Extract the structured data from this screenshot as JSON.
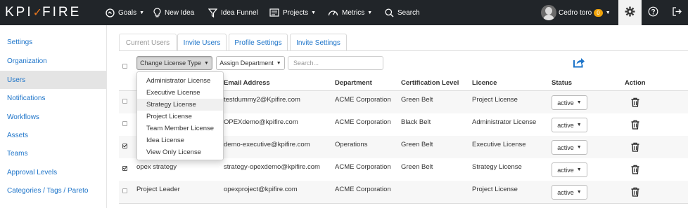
{
  "nav": {
    "logo_left": "KPI",
    "logo_right": "FIRE",
    "goals": "Goals",
    "new_idea": "New Idea",
    "idea_funnel": "Idea Funnel",
    "projects": "Projects",
    "metrics": "Metrics",
    "search": "Search",
    "user_name": "Cedro toro",
    "notification_count": "0"
  },
  "sidebar": {
    "items": [
      {
        "label": "Settings"
      },
      {
        "label": "Organization"
      },
      {
        "label": "Users"
      },
      {
        "label": "Notifications"
      },
      {
        "label": "Workflows"
      },
      {
        "label": "Assets"
      },
      {
        "label": "Teams"
      },
      {
        "label": "Approval Levels"
      },
      {
        "label": "Categories / Tags / Pareto"
      }
    ],
    "active_item": "Users"
  },
  "tabs": [
    {
      "label": "Current Users"
    },
    {
      "label": "Invite Users"
    },
    {
      "label": "Profile Settings"
    },
    {
      "label": "Invite Settings"
    }
  ],
  "toolbar": {
    "change_license_label": "Change License Type",
    "assign_department_label": "Assign Department",
    "search_placeholder": "Search..."
  },
  "license_menu": {
    "items": [
      {
        "label": "Administrator License"
      },
      {
        "label": "Executive License"
      },
      {
        "label": "Strategy License"
      },
      {
        "label": "Project License"
      },
      {
        "label": "Team Member License"
      },
      {
        "label": "Idea License"
      },
      {
        "label": "View Only License"
      }
    ],
    "highlighted": "Strategy License"
  },
  "table": {
    "columns": [
      "Email Address",
      "Department",
      "Certification Level",
      "Licence",
      "Status",
      "Action"
    ],
    "rows": [
      {
        "name": "",
        "email": "testdummy2@Kpifire.com",
        "department": "ACME Corporation",
        "certification": "Green Belt",
        "licence": "Project License",
        "status": "active",
        "checked": false
      },
      {
        "name": "",
        "email": "OPEXdemo@kpifire.com",
        "department": "ACME Corporation",
        "certification": "Black Belt",
        "licence": "Administrator License",
        "status": "active",
        "checked": false
      },
      {
        "name": "",
        "email": "demo-executive@kpifire.com",
        "department": "Operations",
        "certification": "Green Belt",
        "licence": "Executive License",
        "status": "active",
        "checked": true
      },
      {
        "name": "opex strategy",
        "email": "strategy-opexdemo@kpifire.com",
        "department": "ACME Corporation",
        "certification": "Green Belt",
        "licence": "Strategy License",
        "status": "active",
        "checked": true
      },
      {
        "name": "Project Leader",
        "email": "opexproject@kpifire.com",
        "department": "ACME Corporation",
        "certification": "",
        "licence": "Project License",
        "status": "active",
        "checked": false
      }
    ]
  },
  "colors": {
    "topbar": "#212529",
    "link": "#1d74c9",
    "brand_accent": "#e8761e",
    "badge": "#f0a30a"
  }
}
